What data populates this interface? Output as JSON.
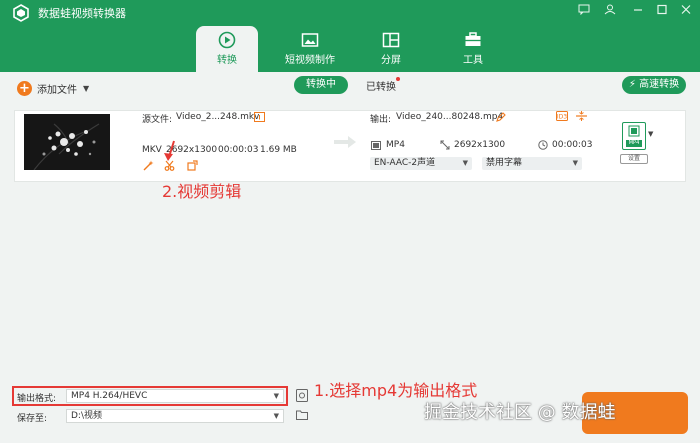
{
  "app": {
    "title": "数据蛙视频转换器"
  },
  "nav_tabs": [
    {
      "label": "转换",
      "icon": "convert-icon",
      "active": true
    },
    {
      "label": "短视频制作",
      "icon": "short-video-icon",
      "active": false
    },
    {
      "label": "分屏",
      "icon": "split-screen-icon",
      "active": false
    },
    {
      "label": "工具",
      "icon": "toolbox-icon",
      "active": false
    }
  ],
  "toolbar": {
    "add_file_label": "添加文件",
    "converting_label": "转换中",
    "converted_label": "已转换",
    "speed_label": "高速转换"
  },
  "file": {
    "source_label": "源文件:",
    "source_name": "Video_2...248.mkv",
    "src_format": "MKV",
    "src_resolution": "2692x1300",
    "src_duration": "00:00:03",
    "src_size": "1.69 MB",
    "output_label": "输出:",
    "output_name": "Video_240...80248.mp4",
    "out_format": "MP4",
    "out_resolution": "2692x1300",
    "out_duration": "00:00:03",
    "audio_track": "EN-AAC-2声道",
    "subtitle": "禁用字幕",
    "format_badge": "MP4",
    "setup_label": "设置"
  },
  "annotations": {
    "step2": "2.视频剪辑",
    "step1": "1.选择mp4为输出格式"
  },
  "bottom": {
    "output_format_label": "输出格式:",
    "output_format_value": "MP4 H.264/HEVC",
    "save_to_label": "保存至:",
    "save_path": "D:\\视频"
  },
  "watermark": "掘金技术社区 @ 数据蛙",
  "colors": {
    "brand_green": "#1f9a5a",
    "accent_orange": "#f07a1e",
    "annotation_red": "#e53935"
  }
}
